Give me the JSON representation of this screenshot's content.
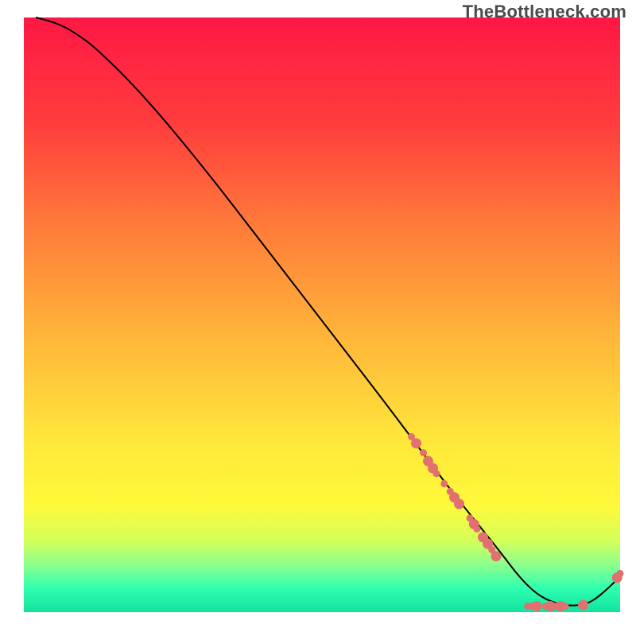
{
  "watermark": "TheBottleneck.com",
  "chart_data": {
    "type": "line",
    "title": "",
    "xlabel": "",
    "ylabel": "",
    "xlim": [
      0,
      100
    ],
    "ylim": [
      0,
      100
    ],
    "gradient_stops": [
      {
        "offset": 0,
        "color": "#ff1744"
      },
      {
        "offset": 18,
        "color": "#ff3d3d"
      },
      {
        "offset": 35,
        "color": "#ff7b3a"
      },
      {
        "offset": 55,
        "color": "#ffb93a"
      },
      {
        "offset": 72,
        "color": "#ffe93a"
      },
      {
        "offset": 82,
        "color": "#fff93a"
      },
      {
        "offset": 88,
        "color": "#d4ff5a"
      },
      {
        "offset": 92,
        "color": "#8dff8d"
      },
      {
        "offset": 96,
        "color": "#2fffb0"
      },
      {
        "offset": 100,
        "color": "#13e29f"
      }
    ],
    "series": [
      {
        "name": "bottleneck-curve",
        "x": [
          2,
          4,
          6,
          8,
          12,
          20,
          30,
          40,
          50,
          60,
          66,
          72,
          76,
          80,
          83,
          86,
          89,
          92,
          95,
          98,
          100
        ],
        "y": [
          100,
          99.5,
          98.8,
          97.8,
          95,
          87,
          75,
          62,
          49,
          36,
          28,
          20,
          15,
          10,
          6,
          3,
          1.5,
          1,
          1.5,
          4,
          6
        ],
        "color": "#000000"
      }
    ],
    "markers": {
      "name": "highlighted-points",
      "color": "#e17070",
      "radius_small": 4.5,
      "radius_large": 6.5,
      "points": [
        {
          "x": 65.0,
          "y": 29.5,
          "r": "s"
        },
        {
          "x": 65.8,
          "y": 28.4,
          "r": "l"
        },
        {
          "x": 67.0,
          "y": 26.8,
          "r": "s"
        },
        {
          "x": 67.8,
          "y": 25.4,
          "r": "l"
        },
        {
          "x": 68.6,
          "y": 24.2,
          "r": "l"
        },
        {
          "x": 69.2,
          "y": 23.3,
          "r": "s"
        },
        {
          "x": 70.5,
          "y": 21.6,
          "r": "s"
        },
        {
          "x": 71.5,
          "y": 20.3,
          "r": "s"
        },
        {
          "x": 72.2,
          "y": 19.3,
          "r": "l"
        },
        {
          "x": 73.0,
          "y": 18.2,
          "r": "l"
        },
        {
          "x": 74.8,
          "y": 15.8,
          "r": "s"
        },
        {
          "x": 75.5,
          "y": 14.8,
          "r": "l"
        },
        {
          "x": 76.0,
          "y": 14.0,
          "r": "s"
        },
        {
          "x": 77.0,
          "y": 12.6,
          "r": "l"
        },
        {
          "x": 77.8,
          "y": 11.5,
          "r": "l"
        },
        {
          "x": 78.5,
          "y": 10.5,
          "r": "s"
        },
        {
          "x": 79.2,
          "y": 9.4,
          "r": "l"
        },
        {
          "x": 84.5,
          "y": 1.0,
          "r": "s"
        },
        {
          "x": 85.2,
          "y": 1.0,
          "r": "s"
        },
        {
          "x": 86.0,
          "y": 1.0,
          "r": "l"
        },
        {
          "x": 87.5,
          "y": 1.0,
          "r": "s"
        },
        {
          "x": 88.3,
          "y": 1.0,
          "r": "l"
        },
        {
          "x": 89.1,
          "y": 1.0,
          "r": "s"
        },
        {
          "x": 90.0,
          "y": 1.0,
          "r": "l"
        },
        {
          "x": 90.8,
          "y": 1.0,
          "r": "s"
        },
        {
          "x": 93.8,
          "y": 1.2,
          "r": "l"
        },
        {
          "x": 99.5,
          "y": 5.8,
          "r": "l"
        },
        {
          "x": 100.0,
          "y": 6.5,
          "r": "s"
        }
      ]
    }
  }
}
